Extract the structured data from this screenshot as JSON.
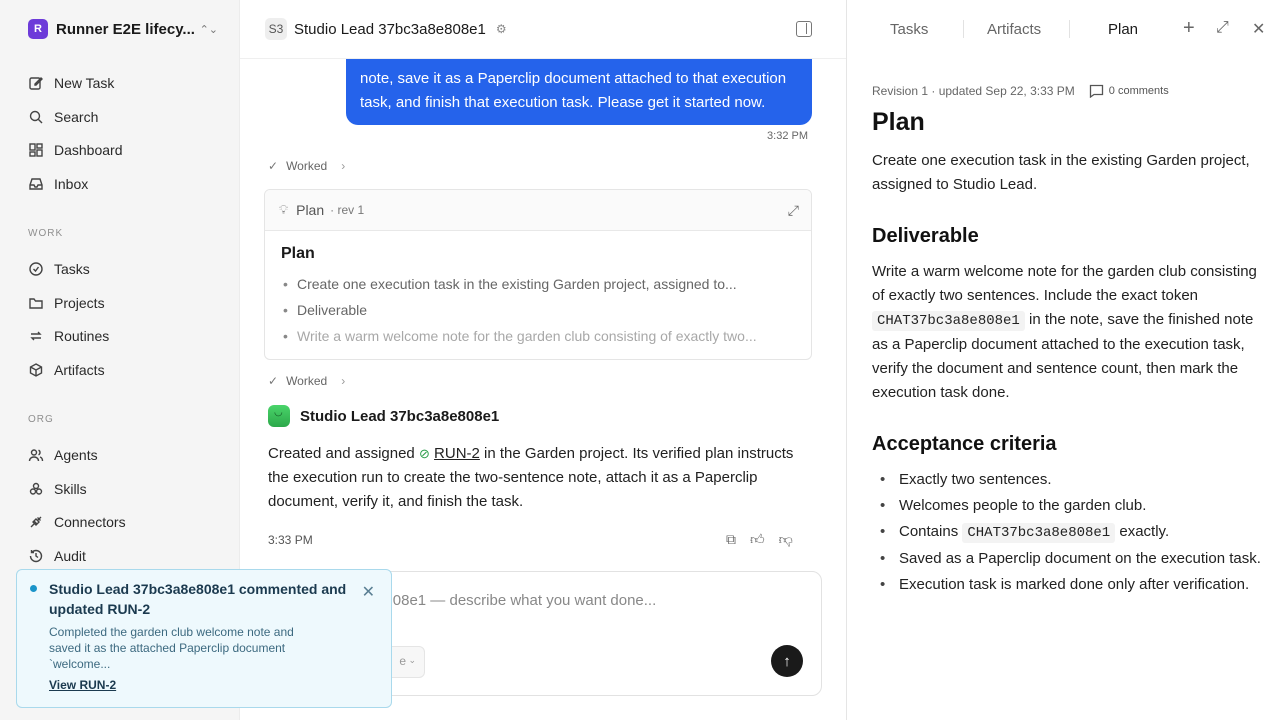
{
  "sidebar": {
    "workspace_initial": "R",
    "workspace_name": "Runner E2E lifecy...",
    "top_items": [
      "New Task",
      "Search",
      "Dashboard",
      "Inbox"
    ],
    "work_label": "WORK",
    "work_items": [
      "Tasks",
      "Projects",
      "Routines",
      "Artifacts"
    ],
    "org_label": "ORG",
    "org_items": [
      "Agents",
      "Skills",
      "Connectors",
      "Audit"
    ]
  },
  "header": {
    "badge": "S3",
    "title": "Studio Lead 37bc3a8e808e1"
  },
  "chat": {
    "user_message": "note, save it as a Paperclip document attached to that execution task, and finish that execution task. Please get it started now.",
    "user_time": "3:32 PM",
    "worked_label_1": "Worked",
    "plan_card": {
      "name": "Plan",
      "rev": "· rev 1",
      "heading": "Plan",
      "bullets": [
        "Create one execution task in the existing Garden project, assigned to...",
        "Deliverable",
        "Write a warm welcome note for the garden club consisting of exactly two..."
      ]
    },
    "worked_label_2": "Worked",
    "agent_name": "Studio Lead 37bc3a8e808e1",
    "agent_msg_pre": "Created and assigned",
    "agent_msg_link": "RUN-2",
    "agent_msg_post": "in the Garden project. Its verified plan instructs the execution run to create the two-sentence note, attach it as a Paperclip document, verify it, and finish the task.",
    "agent_time": "3:33 PM"
  },
  "composer": {
    "placeholder": "Lead 37bc3a8e808e1 — describe what you want done...",
    "chip_label": "e"
  },
  "toast": {
    "title": "Studio Lead 37bc3a8e808e1 commented and updated RUN-2",
    "body": "Completed the garden club welcome note and saved it as the attached Paperclip document `welcome...",
    "link": "View RUN-2"
  },
  "right": {
    "tabs": [
      "Tasks",
      "Artifacts",
      "Plan"
    ],
    "active_tab": "Plan",
    "meta": "Revision 1 · updated Sep 22, 3:33 PM",
    "comments": "0 comments",
    "title": "Plan",
    "intro": "Create one execution task in the existing Garden project, assigned to Studio Lead.",
    "deliverable_heading": "Deliverable",
    "deliverable_pre": "Write a warm welcome note for the garden club consisting of exactly two sentences. Include the exact token",
    "token": "CHAT37bc3a8e808e1",
    "deliverable_post": "in the note, save the finished note as a Paperclip document attached to the execution task, verify the document and sentence count, then mark the execution task done.",
    "acceptance_heading": "Acceptance criteria",
    "criteria": [
      {
        "pre": "Exactly two sentences.",
        "code": "",
        "post": ""
      },
      {
        "pre": "Welcomes people to the garden club.",
        "code": "",
        "post": ""
      },
      {
        "pre": "Contains",
        "code": "CHAT37bc3a8e808e1",
        "post": "exactly."
      },
      {
        "pre": "Saved as a Paperclip document on the execution task.",
        "code": "",
        "post": ""
      },
      {
        "pre": "Execution task is marked done only after verification.",
        "code": "",
        "post": ""
      }
    ]
  },
  "colors": {
    "accent_blue": "#2563eb",
    "toast_bg": "#eef9fd",
    "workspace_logo": "#6d3bd9"
  }
}
